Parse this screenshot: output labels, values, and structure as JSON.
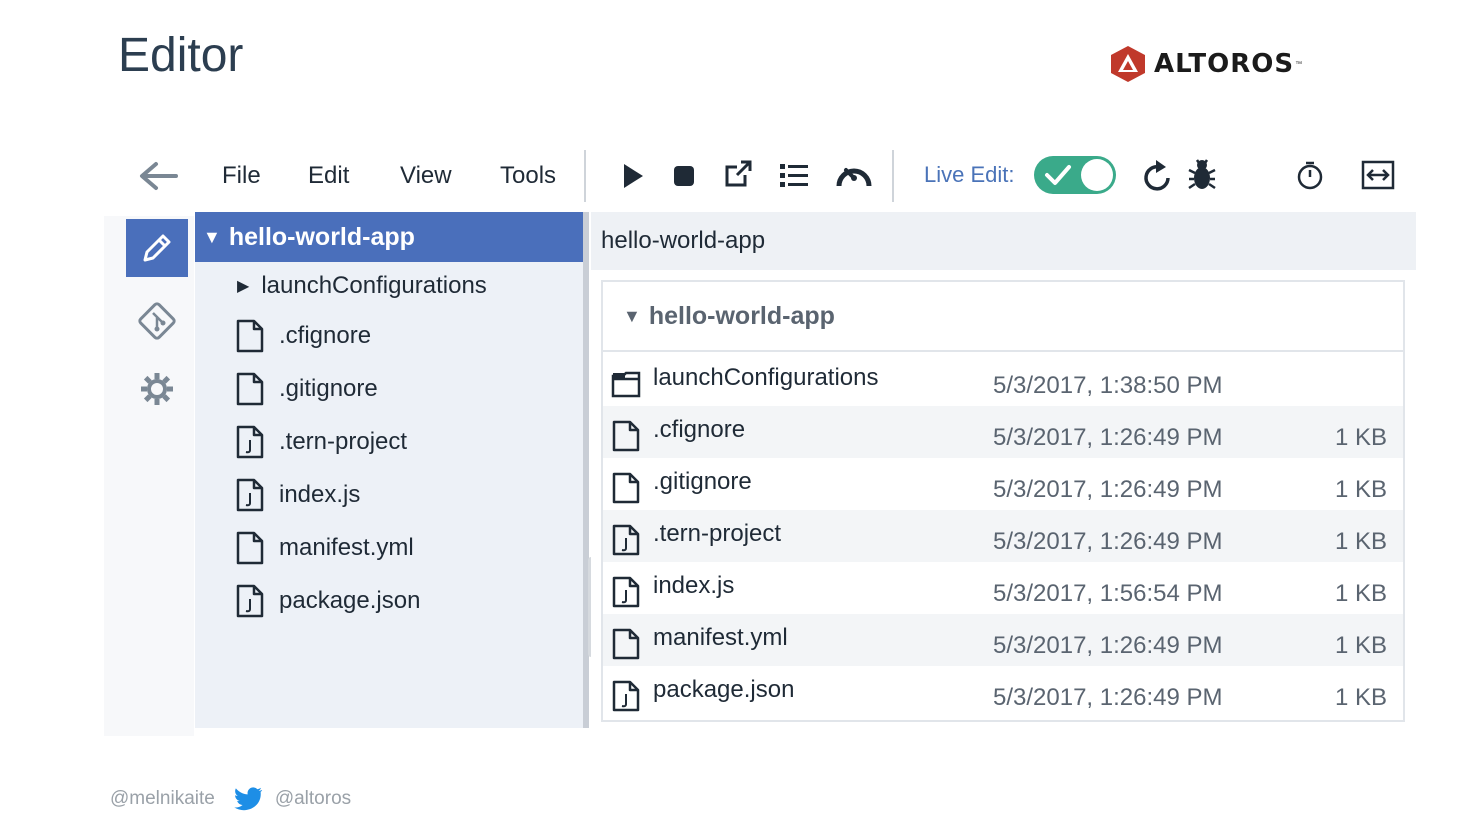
{
  "slide": {
    "title": "Editor"
  },
  "logo": {
    "text": "ALTOROS",
    "tm": "™",
    "brand_color": "#c0392b"
  },
  "colors": {
    "accent": "#4a6fbb",
    "toggle_on": "#3aaa8a",
    "live_label": "#4a73b8"
  },
  "toolbar": {
    "menus": [
      "File",
      "Edit",
      "View",
      "Tools"
    ],
    "live_edit_label": "Live Edit:",
    "live_edit_on": true,
    "icons": [
      "back-arrow-icon",
      "play-icon",
      "stop-icon",
      "open-external-icon",
      "list-icon",
      "deploy-gauge-icon",
      "refresh-icon",
      "bug-icon",
      "timer-icon",
      "fit-width-icon"
    ]
  },
  "tree": {
    "root": "hello-world-app",
    "items": [
      {
        "label": "launchConfigurations",
        "type": "folder"
      },
      {
        "label": ".cfignore",
        "type": "file"
      },
      {
        "label": ".gitignore",
        "type": "file"
      },
      {
        "label": ".tern-project",
        "type": "json"
      },
      {
        "label": "index.js",
        "type": "json"
      },
      {
        "label": "manifest.yml",
        "type": "file"
      },
      {
        "label": "package.json",
        "type": "json"
      }
    ]
  },
  "content": {
    "breadcrumb": "hello-world-app",
    "panel_title": "hello-world-app",
    "files": [
      {
        "name": "launchConfigurations",
        "type": "folder",
        "date": "5/3/2017, 1:38:50 PM",
        "size": ""
      },
      {
        "name": ".cfignore",
        "type": "file",
        "date": "5/3/2017, 1:26:49 PM",
        "size": "1 KB"
      },
      {
        "name": ".gitignore",
        "type": "file",
        "date": "5/3/2017, 1:26:49 PM",
        "size": "1 KB"
      },
      {
        "name": ".tern-project",
        "type": "json",
        "date": "5/3/2017, 1:26:49 PM",
        "size": "1 KB"
      },
      {
        "name": "index.js",
        "type": "json",
        "date": "5/3/2017, 1:56:54 PM",
        "size": "1 KB"
      },
      {
        "name": "manifest.yml",
        "type": "file",
        "date": "5/3/2017, 1:26:49 PM",
        "size": "1 KB"
      },
      {
        "name": "package.json",
        "type": "json",
        "date": "5/3/2017, 1:26:49 PM",
        "size": "1 KB"
      }
    ]
  },
  "footer": {
    "handle_left": "@melnikaite",
    "handle_right": "@altoros"
  }
}
